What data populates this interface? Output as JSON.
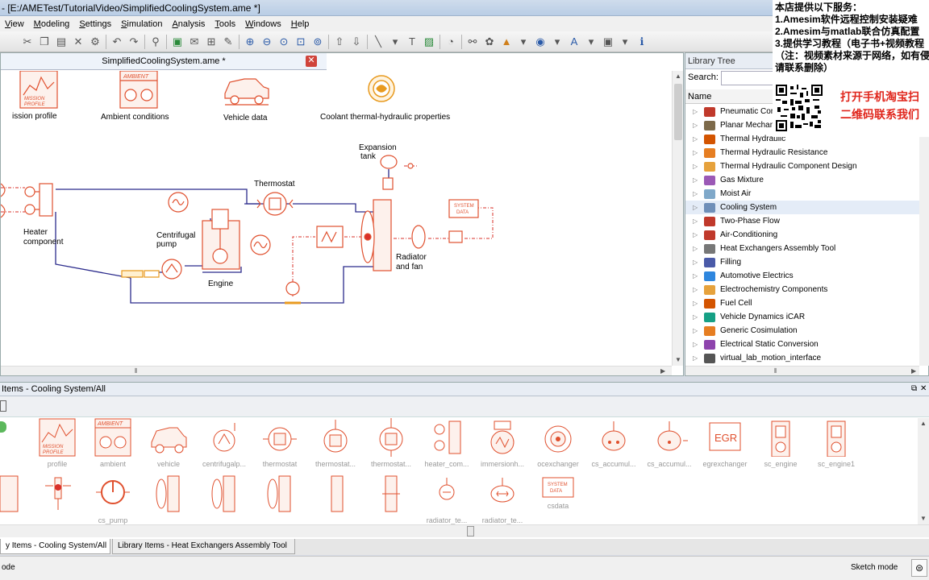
{
  "window": {
    "title": "- [E:/AMETest/TutorialVideo/SimplifiedCoolingSystem.ame *]"
  },
  "menu": [
    "View",
    "Modeling",
    "Settings",
    "Simulation",
    "Analysis",
    "Tools",
    "Windows",
    "Help"
  ],
  "sketch": {
    "tab_title": "SimplifiedCoolingSystem.ame *",
    "close_symbol": "✕",
    "labels": {
      "mission_profile": "ission profile",
      "ambient_conditions": "Ambient conditions",
      "vehicle_data": "Vehicle data",
      "coolant_properties": "Coolant thermal-hydraulic properties",
      "expansion_tank_1": "Expansion",
      "expansion_tank_2": "tank",
      "thermostat": "Thermostat",
      "heater_1": "Heater",
      "heater_2": "component",
      "pump_1": "Centrifugal",
      "pump_2": "pump",
      "engine": "Engine",
      "radiator_1": "Radiator",
      "radiator_2": "and fan",
      "system_data_1": "SYSTEM",
      "system_data_2": "DATA"
    },
    "icon_text": {
      "mission_1": "MISSION",
      "mission_2": "PROFILE",
      "ambient": "AMBIENT"
    }
  },
  "library_tree": {
    "title": "Library Tree",
    "search_label": "Search:",
    "search_value": "",
    "column_name": "Name",
    "items": [
      {
        "label": "Pneumatic Com",
        "color": "#c0392b"
      },
      {
        "label": "Planar Mechan",
        "color": "#7d6a4a"
      },
      {
        "label": "Thermal Hydraulic",
        "color": "#d35400"
      },
      {
        "label": "Thermal Hydraulic Resistance",
        "color": "#e67e22"
      },
      {
        "label": "Thermal Hydraulic Component Design",
        "color": "#e6a23c"
      },
      {
        "label": "Gas Mixture",
        "color": "#9b59b6"
      },
      {
        "label": "Moist Air",
        "color": "#7fa8c9"
      },
      {
        "label": "Cooling System",
        "color": "#6f8fb8"
      },
      {
        "label": "Two-Phase Flow",
        "color": "#c0392b"
      },
      {
        "label": "Air-Conditioning",
        "color": "#c0392b"
      },
      {
        "label": "Heat Exchangers Assembly Tool",
        "color": "#777777"
      },
      {
        "label": "Filling",
        "color": "#4a5aa8"
      },
      {
        "label": "Automotive Electrics",
        "color": "#2e86de"
      },
      {
        "label": "Electrochemistry Components",
        "color": "#e6a23c"
      },
      {
        "label": "Fuel Cell",
        "color": "#d35400"
      },
      {
        "label": "Vehicle Dynamics iCAR",
        "color": "#16a085"
      },
      {
        "label": "Generic Cosimulation",
        "color": "#e67e22"
      },
      {
        "label": "Electrical Static Conversion",
        "color": "#8e44ad"
      },
      {
        "label": "virtual_lab_motion_interface",
        "color": "#555555"
      }
    ],
    "selected_index": 7
  },
  "overlay": {
    "lines": [
      "本店提供以下服务：",
      "1.Amesim软件远程控制安装疑难",
      "2.Amesim与matlab联合仿真配置",
      "3.提供学习教程（电子书+视频教程",
      "（注：视频素材来源于网络，如有侵",
      "请联系删除）"
    ],
    "red_1": "打开手机淘宝扫",
    "red_2": "二维码联系我们"
  },
  "library_items": {
    "title": "Items - Cooling System/All",
    "row1": [
      "profile",
      "ambient",
      "vehicle",
      "centrifugalp...",
      "thermostat",
      "thermostat...",
      "thermostat...",
      "heater_com...",
      "immersionh...",
      "ocexchanger",
      "cs_accumul...",
      "cs_accumul...",
      "egrexchanger",
      "sc_engine",
      "sc_engine1"
    ],
    "row2": [
      "",
      "",
      "cs_pump",
      "",
      "",
      "",
      "",
      "",
      "radiator_te...",
      "radiator_te...",
      "csdata"
    ],
    "egr_text": "EGR"
  },
  "bottom_tabs": [
    "y Items - Cooling System/All",
    "Library Items - Heat Exchangers Assembly Tool"
  ],
  "status": {
    "left": "ode",
    "right": "Sketch mode"
  },
  "colors": {
    "component": "#e0502e",
    "pipe_blue": "#2b2b8c",
    "signal_red": "#d9302a"
  }
}
